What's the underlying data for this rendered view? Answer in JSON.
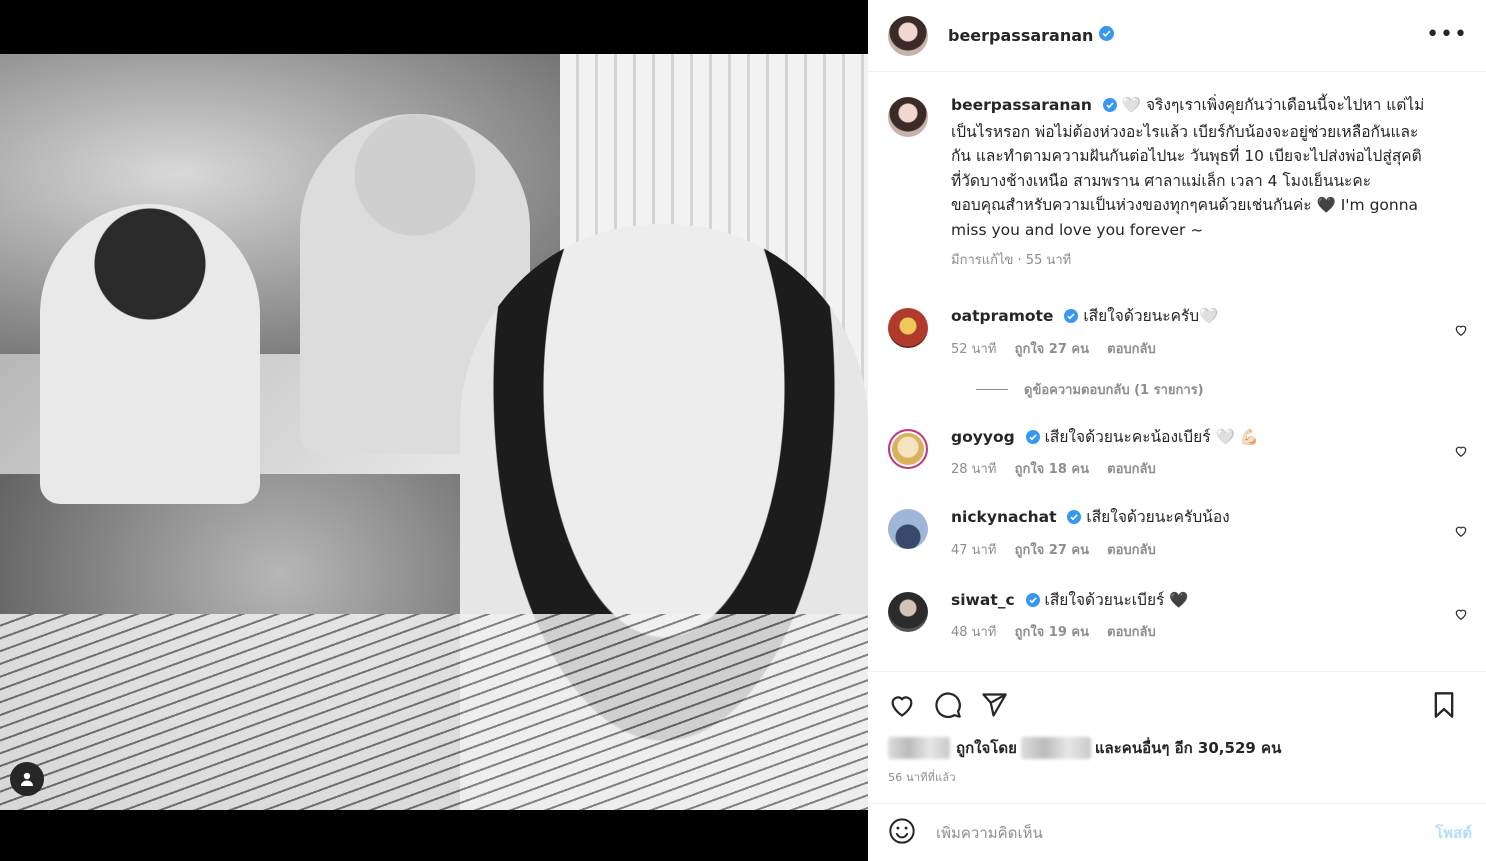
{
  "post": {
    "username": "beerpassaranan",
    "more_label": "•••",
    "caption_text": "🤍 จริงๆเราเพิ่งคุยกันว่าเดือนนี้จะไปหา แต่ไม่เป็นไรหรอก พ่อไม่ต้องห่วงอะไรแล้ว เบียร์กับน้องจะอยู่ช่วยเหลือกันและกัน และทำตามความฝันกันต่อไปนะ วันพุธที่ 10 เบียจะไปส่งพ่อไปสู่สุคติ ที่วัดบางช้างเหนือ สามพราน ศาลาแม่เล็ก เวลา 4 โมงเย็นนะคะ ขอบคุณสำหรับความเป็นห่วงของทุกๆคนด้วยเช่นกันค่ะ 🖤 I'm gonna miss you and love you forever ~",
    "edited_label": "มีการแก้ไข · 55 นาที"
  },
  "comments": [
    {
      "username": "oatpramote",
      "text": "เสียใจด้วยนะครับ🤍",
      "time": "52 นาที",
      "likes": "ถูกใจ 27 คน",
      "reply": "ตอบกลับ"
    },
    {
      "username": "goyyog",
      "text": "เสียใจด้วยนะคะน้องเบียร์ 🤍 💪🏻",
      "time": "28 นาที",
      "likes": "ถูกใจ 18 คน",
      "reply": "ตอบกลับ"
    },
    {
      "username": "nickynachat",
      "text": "เสียใจด้วยนะครับน้อง",
      "time": "47 นาที",
      "likes": "ถูกใจ 27 คน",
      "reply": "ตอบกลับ"
    },
    {
      "username": "siwat_c",
      "text": "เสียใจด้วยนะเบียร์ 🖤",
      "time": "48 นาที",
      "likes": "ถูกใจ 19 คน",
      "reply": "ตอบกลับ"
    }
  ],
  "view_replies": "ดูข้อความตอบกลับ (1 รายการ)",
  "likes_line": {
    "prefix": "ถูกใจโดย",
    "suffix": "และคนอื่นๆ อีก 30,529 คน"
  },
  "timestamp": "56 นาทีที่แล้ว",
  "add_comment": {
    "placeholder": "เพิ่มความคิดเห็น",
    "post_label": "โพสต์"
  },
  "colors": {
    "verified": "#3897f0",
    "post_disabled": "#b2dffc",
    "secondary": "#8e8e8e"
  },
  "icons": [
    "user-tag-icon",
    "more-icon",
    "verified-icon",
    "heart-icon",
    "comment-icon",
    "share-icon",
    "bookmark-icon",
    "emoji-icon"
  ]
}
